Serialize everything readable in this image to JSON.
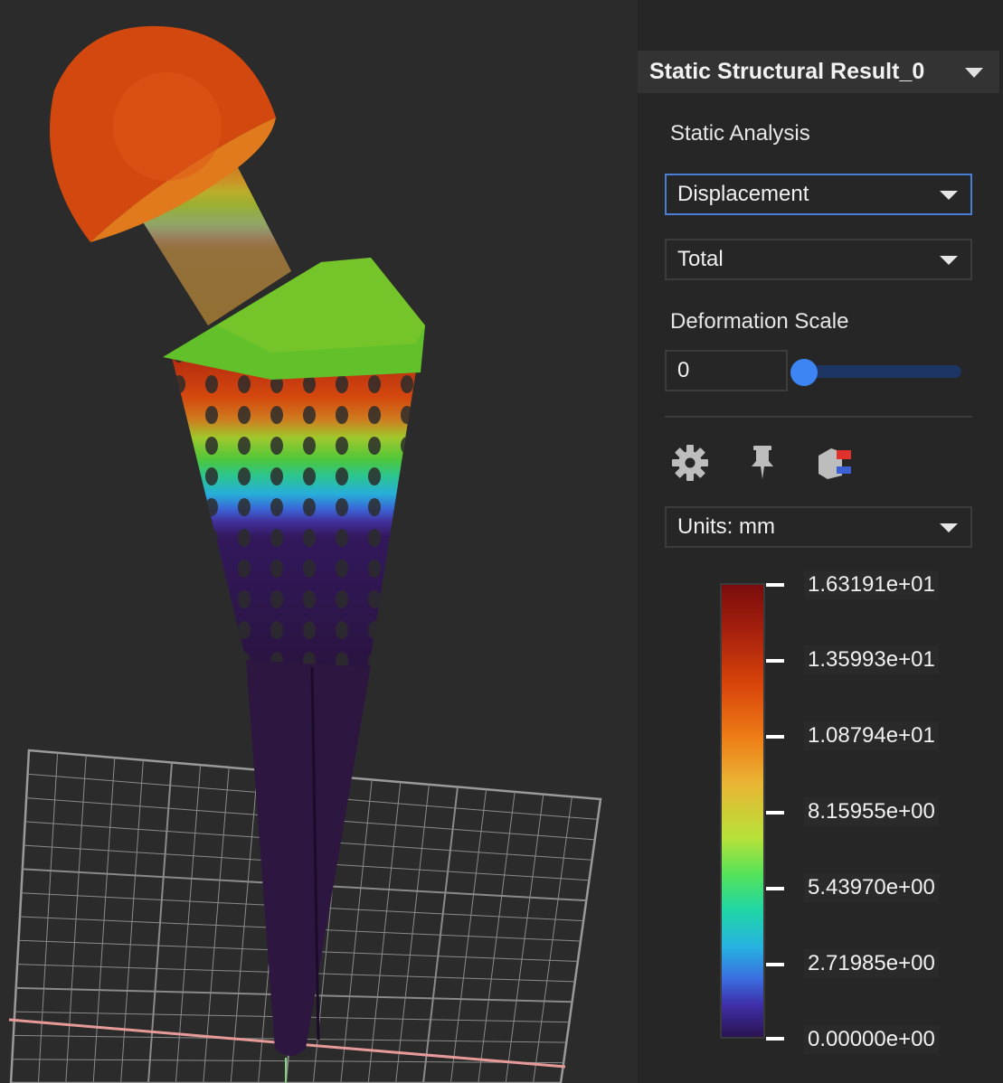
{
  "panel": {
    "title": "Static Structural Result_0",
    "analysis_label": "Static Analysis",
    "result_type": "Displacement",
    "component": "Total",
    "deformation_scale_label": "Deformation Scale",
    "deformation_scale_value": "0",
    "deformation_slider_fraction": 0,
    "units": "Units: mm",
    "tools": [
      "gear-icon",
      "pin-icon",
      "probe-icon"
    ]
  },
  "legend": {
    "labels": [
      "1.63191e+01",
      "1.35993e+01",
      "1.08794e+01",
      "8.15955e+00",
      "5.43970e+00",
      "2.71985e+00",
      "0.00000e+00"
    ]
  },
  "colors": {
    "accent": "#3d84f5",
    "active_border": "#4a7fd6",
    "panel_bg": "#262626",
    "viewport_bg": "#2b2b2b"
  }
}
